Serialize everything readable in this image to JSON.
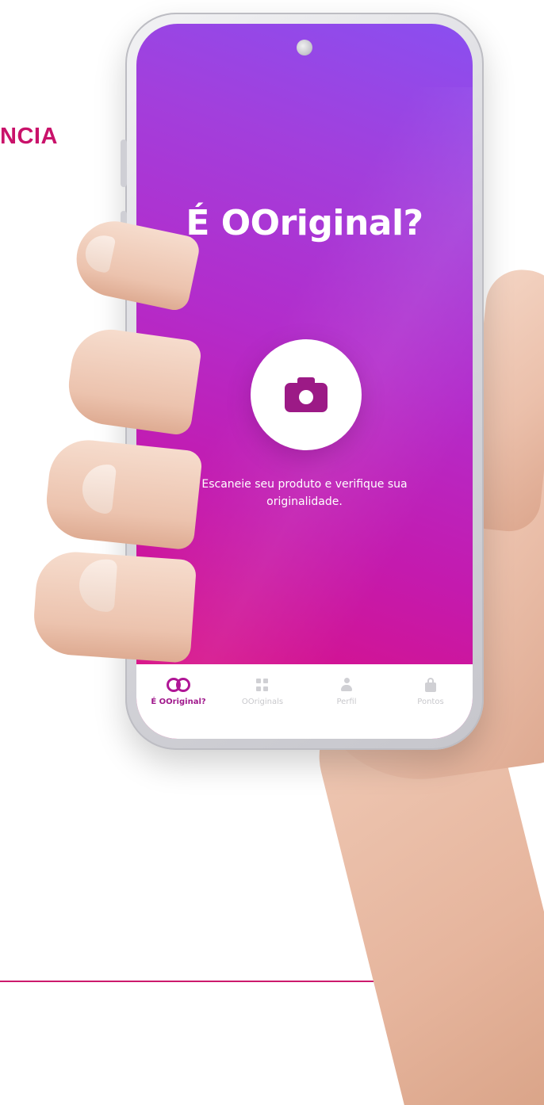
{
  "page": {
    "side_heading": "NCIA"
  },
  "app": {
    "title": "É OOriginal?",
    "instruction": "Escaneie seu produto e verifique sua originalidade.",
    "scan_button_icon": "camera-icon",
    "colors": {
      "gradient_top": "#8a4ff0",
      "gradient_bottom": "#df0c77",
      "accent": "#a0198c",
      "heading": "#c9126a"
    }
  },
  "nav": {
    "items": [
      {
        "label": "É OOriginal?",
        "icon": "infinity-icon",
        "active": true
      },
      {
        "label": "OOriginals",
        "icon": "grid-icon",
        "active": false
      },
      {
        "label": "Perfil",
        "icon": "person-icon",
        "active": false
      },
      {
        "label": "Pontos",
        "icon": "bag-icon",
        "active": false
      }
    ]
  }
}
